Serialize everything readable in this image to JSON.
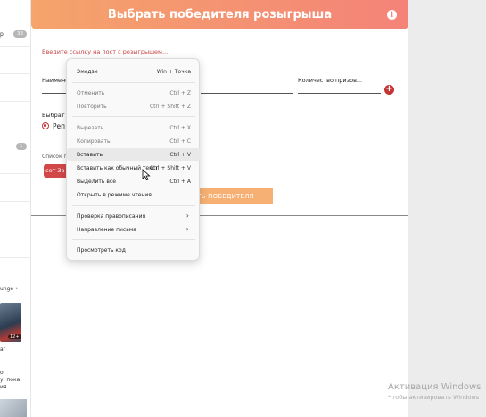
{
  "left_panel": {
    "top_item_fragment": "р",
    "badge_top": "33",
    "badge_mid": "1",
    "lounge_text": "unge •",
    "thumb_badge": "12+",
    "texts": [
      "ar",
      "о",
      "y, пока",
      "ия",
      "сть"
    ]
  },
  "card": {
    "title": "Выбрать победителя розыгрыша",
    "info_glyph": "i",
    "url_placeholder": "Введите ссылку на пост с розыгрышем...",
    "name_label_fragment": "Наимено",
    "prize_qty_label": "Количество призов...",
    "add_symbol": "+",
    "choose_label_fragment": "Выбрат",
    "radio_label_fragment": "Реп",
    "list_label_fragment": "Список п",
    "chip_label": "сет За",
    "choose_button_fragment": "ЛИТЬ ПОБЕДИТЕЛЯ"
  },
  "context_menu": {
    "items": [
      {
        "label": "Эмодзи",
        "shortcut": "Win + Точка"
      },
      {
        "label": "Отменить",
        "shortcut": "Ctrl + Z"
      },
      {
        "label": "Повторить",
        "shortcut": "Ctrl + Shift + Z"
      },
      {
        "label": "Вырезать",
        "shortcut": "Ctrl + X"
      },
      {
        "label": "Копировать",
        "shortcut": "Ctrl + C"
      },
      {
        "label": "Вставить",
        "shortcut": "Ctrl + V"
      },
      {
        "label": "Вставить как обычный текст",
        "shortcut": "Ctrl + Shift + V"
      },
      {
        "label": "Выделить все",
        "shortcut": "Ctrl + A"
      },
      {
        "label": "Открыть в режиме чтения",
        "shortcut": ""
      },
      {
        "label": "Проверка правописания",
        "shortcut": ""
      },
      {
        "label": "Направление письма",
        "shortcut": ""
      },
      {
        "label": "Просмотреть код",
        "shortcut": ""
      }
    ],
    "submenu_arrow": "›"
  },
  "watermark": {
    "line1": "Активация Windows",
    "line2": "Чтобы активировать Windows"
  },
  "colors": {
    "header_start": "#f5a46b",
    "header_end": "#f48378",
    "accent_red": "#c53434",
    "button_orange": "#f6b073"
  }
}
